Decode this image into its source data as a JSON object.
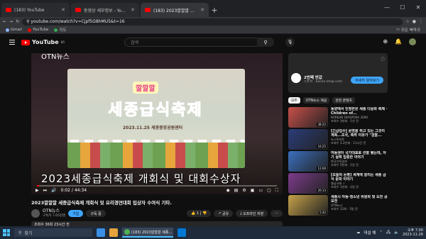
{
  "browser": {
    "tabs": [
      {
        "label": "(183) YouTube",
        "active": false
      },
      {
        "label": "동영상 세부정보 - YouTube Stu",
        "active": false
      },
      {
        "label": "(183) 2023깔깔깔 세종급식축",
        "active": true
      }
    ],
    "new_tab": "+",
    "url": "youtube.com/watch?v=Cjpf5G8hMU5&t=16",
    "bookmarks": [
      "Gmail",
      "YouTube",
      "지도"
    ],
    "all_bookmarks": "모든 북마크"
  },
  "youtube": {
    "logo_text": "YouTube",
    "logo_region": "KR",
    "search_placeholder": "검색"
  },
  "player": {
    "channel_watermark": "OTN뉴스",
    "screen_kk": "깔깔깔",
    "screen_title": "세종급식축제",
    "screen_date": "2023.11.25 세종중앙공원센터",
    "subtitle": "2023세종급식축제 개회식 및 대회수상자",
    "time": "0:02 / 44:34",
    "progress": 0.01
  },
  "video": {
    "title": "2023깔깔깔 세종급식축제 개회식 및 요리경연대회 입상자 수여식 기타.",
    "channel": "OTN뉴스",
    "subscribers": "구독자 7.65천명",
    "join_label": "가입",
    "subscribe_label": "구독 중",
    "likes": "1",
    "share_label": "공유",
    "download_label": "오프라인 저장",
    "more_label": "···",
    "description": "조회수 36회  23시간 전"
  },
  "ad": {
    "title": "2번째 반값",
    "sub": "스폰서 · bacon-shop.com",
    "button": "자세히 알아보기"
  },
  "chips": [
    {
      "label": "모두",
      "on": true
    },
    {
      "label": "OTN뉴스 제공",
      "on": false
    },
    {
      "label": "관련 콘텐츠",
      "on": false
    }
  ],
  "recommendations": [
    {
      "title": "동양에서 인정받은 세종 다문화 축제 · Children of...",
      "channel": "KOREAN DIASPORA 3000",
      "meta": "조회수 3천회 · 1년 전",
      "duration": "38:22",
      "color": "#c9504a"
    },
    {
      "title": "[긴급입수] 운명을 쥐고 있는 그것이 계획...조국, 축하 이유가 \"검찰...",
      "channel": "뉴스토마토",
      "meta": "조회수 3.2만회 · 11시간 전",
      "duration": "16:25",
      "color": "#2b3d7a"
    },
    {
      "title": "여동생이 국가대표로 선발 됐는데, 자기 실력 입증한 이야기",
      "channel": "한국기독일보",
      "meta": "조회수 5천회 · 1일 전",
      "duration": "12:00",
      "color": "#3b6fbf"
    },
    {
      "title": "[오늘의 논평] 세계에 알리는 세종 급식 문화 이야기",
      "channel": "충남사회 ✓",
      "meta": "조회수 1만회 · 2일 전",
      "duration": "20:13",
      "color": "#7d3c8c"
    },
    {
      "title": "세종시 아동·청소년 위원회 및 도전 공모전",
      "channel": "OTN뉴스",
      "meta": "조회수 12회 · 3일 전",
      "duration": "5:42",
      "color": "#c5a14a"
    }
  ],
  "taskbar": {
    "search": "찾기",
    "active_app": "(183) 2023깔깔깔 세종...",
    "weather": "대설 해",
    "time": "오후 7:00",
    "date": "2023-11-26"
  }
}
